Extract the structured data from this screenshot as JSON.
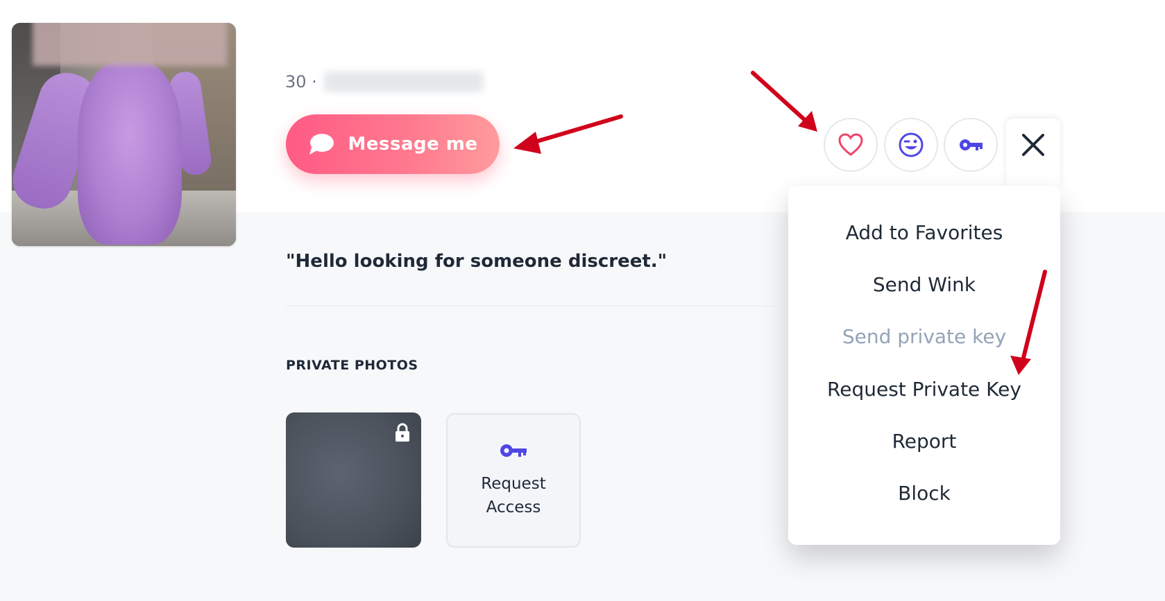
{
  "profile": {
    "age_prefix": "30 ·",
    "message_button_label": "Message me",
    "tagline": "\"Hello looking for someone discreet.\""
  },
  "actions": {
    "favorite_icon": "heart-icon",
    "wink_icon": "wink-icon",
    "key_icon": "key-icon",
    "close_icon": "close-icon"
  },
  "menu": {
    "items": [
      {
        "label": "Add to Favorites",
        "disabled": false
      },
      {
        "label": "Send Wink",
        "disabled": false
      },
      {
        "label": "Send private key",
        "disabled": true
      },
      {
        "label": "Request Private Key",
        "disabled": false
      },
      {
        "label": "Report",
        "disabled": false
      },
      {
        "label": "Block",
        "disabled": false
      }
    ]
  },
  "private_photos": {
    "section_label": "PRIVATE PHOTOS",
    "request_access_label": "Request Access"
  },
  "colors": {
    "accent_pink": "#ff5a84",
    "key_purple": "#4f46e5",
    "arrow_red": "#d0021b",
    "disabled_text": "#94a3b8"
  }
}
